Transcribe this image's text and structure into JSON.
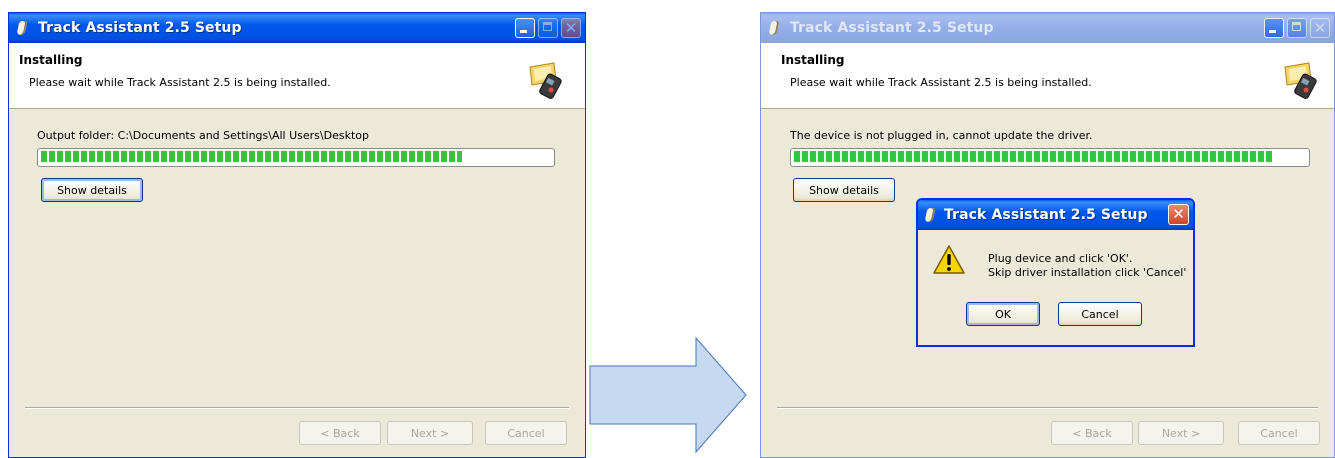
{
  "left_window": {
    "title": "Track Assistant 2.5 Setup",
    "header_title": "Installing",
    "header_subtitle": "Please wait while Track Assistant 2.5 is being installed.",
    "status_text": "Output folder: C:\\Documents and Settings\\All Users\\Desktop",
    "progress": 0.82,
    "show_details_label": "Show details",
    "back_label": "< Back",
    "next_label": "Next >",
    "cancel_label": "Cancel"
  },
  "right_window": {
    "title": "Track Assistant 2.5 Setup",
    "header_title": "Installing",
    "header_subtitle": "Please wait while Track Assistant 2.5 is being installed.",
    "status_text": "The device is not plugged in, cannot update the driver.",
    "progress": 0.93,
    "show_details_label": "Show details",
    "back_label": "< Back",
    "next_label": "Next >",
    "cancel_label": "Cancel"
  },
  "dialog": {
    "title": "Track Assistant 2.5 Setup",
    "message_line1": "Plug device and click 'OK'.",
    "message_line2": "Skip driver installation click 'Cancel'",
    "ok_label": "OK",
    "cancel_label": "Cancel"
  },
  "icons": {
    "window_icon": "phone-icon",
    "header_icon": "installer-device-icon",
    "dialog_icon": "warning-icon",
    "transition": "arrow-right-icon"
  },
  "colors": {
    "titlebar_active": "#0058ee",
    "titlebar_inactive": "#95aee8",
    "progress_fill": "#39c23c",
    "window_bg": "#ece9d8",
    "arrow_fill": "#c6d9f1"
  }
}
